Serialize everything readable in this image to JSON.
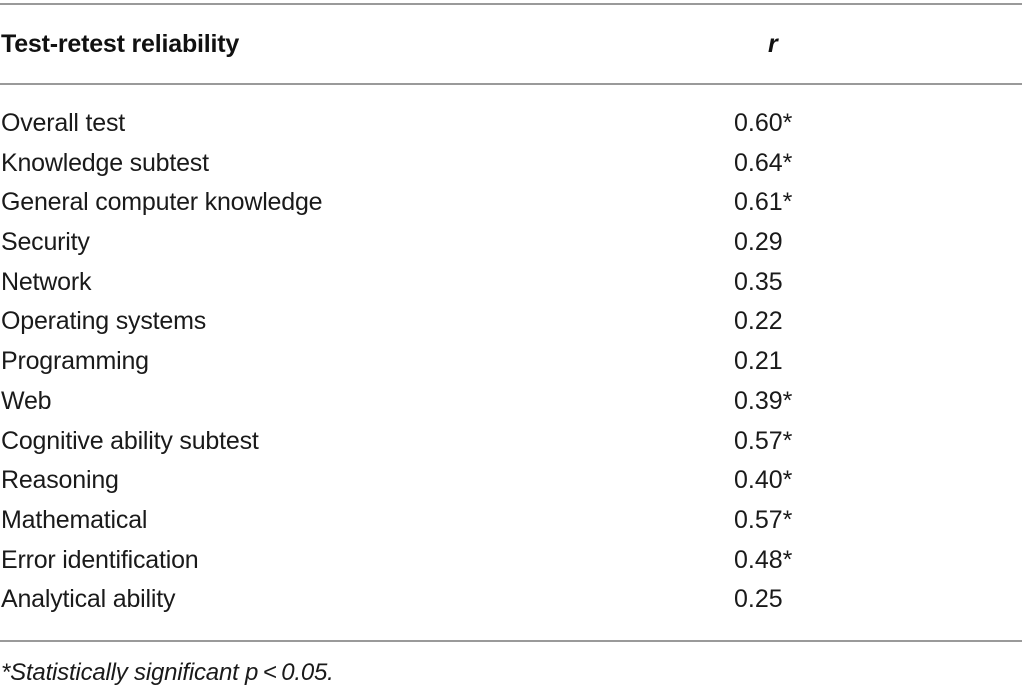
{
  "table": {
    "headers": {
      "label": "Test-retest reliability",
      "value": "r"
    },
    "rows": [
      {
        "label": "Overall test",
        "value": "0.60*"
      },
      {
        "label": "Knowledge subtest",
        "value": "0.64*"
      },
      {
        "label": "General computer knowledge",
        "value": "0.61*"
      },
      {
        "label": "Security",
        "value": "0.29"
      },
      {
        "label": "Network",
        "value": "0.35"
      },
      {
        "label": "Operating systems",
        "value": "0.22"
      },
      {
        "label": "Programming",
        "value": "0.21"
      },
      {
        "label": "Web",
        "value": "0.39*"
      },
      {
        "label": "Cognitive ability subtest",
        "value": "0.57*"
      },
      {
        "label": "Reasoning",
        "value": "0.40*"
      },
      {
        "label": "Mathematical",
        "value": "0.57*"
      },
      {
        "label": "Error identification",
        "value": "0.48*"
      },
      {
        "label": "Analytical ability",
        "value": "0.25"
      }
    ],
    "footnote": "*Statistically significant p < 0.05."
  },
  "colors": {
    "rule": "#9a9a9a",
    "text": "#1a1a1a"
  }
}
